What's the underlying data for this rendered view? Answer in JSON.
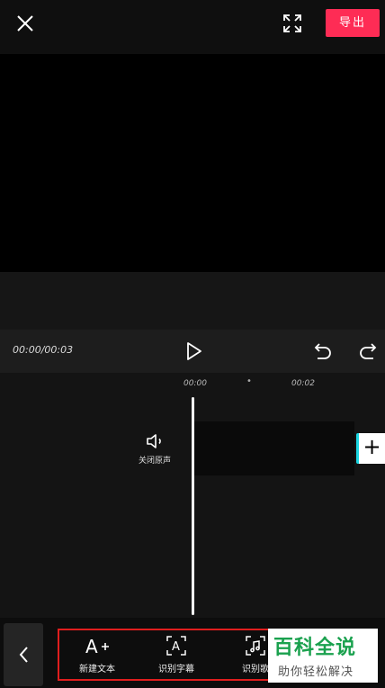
{
  "header": {
    "close_icon": "close-icon",
    "fullscreen_icon": "fullscreen-icon",
    "export_label": "导出",
    "export_color": "#fe2c55"
  },
  "controls": {
    "timecode": "00:00/00:03",
    "play_icon": "play-icon",
    "undo_icon": "undo-icon",
    "redo_icon": "redo-icon"
  },
  "timeline": {
    "ruler": [
      "00:00",
      "•",
      "00:02"
    ],
    "audio_label": "关闭原声",
    "add_icon": "+"
  },
  "toolbar": {
    "back_icon": "chevron-left-icon",
    "tools": [
      {
        "icon": "A+",
        "label": "新建文本"
      },
      {
        "icon": "A",
        "label": "识别字幕"
      },
      {
        "icon": "music-note",
        "label": "识别歌"
      }
    ],
    "highlight_color": "#e01e1e"
  },
  "watermark": {
    "title": "百科全说",
    "subtitle": "助你轻松解决"
  }
}
